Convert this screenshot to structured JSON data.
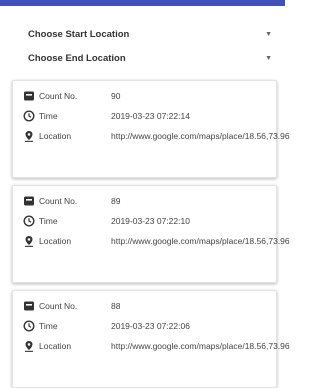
{
  "filters": {
    "start_label": "Choose Start Location",
    "end_label": "Choose End Location"
  },
  "labels": {
    "count": "Count No.",
    "time": "Time",
    "location": "Location"
  },
  "records": [
    {
      "count": "90",
      "time": "2019-03-23 07:22:14",
      "location": "http://www.google.com/maps/place/18.56,73.96"
    },
    {
      "count": "89",
      "time": "2019-03-23 07:22:10",
      "location": "http://www.google.com/maps/place/18.56,73.96"
    },
    {
      "count": "88",
      "time": "2019-03-23 07:22:06",
      "location": "http://www.google.com/maps/place/18.56,73.96"
    }
  ],
  "icons": {
    "count": "counter-icon",
    "time": "clock-icon",
    "location": "location-pin-icon"
  },
  "colors": {
    "app_bar": "#3f51b5",
    "icon": "#333333"
  }
}
